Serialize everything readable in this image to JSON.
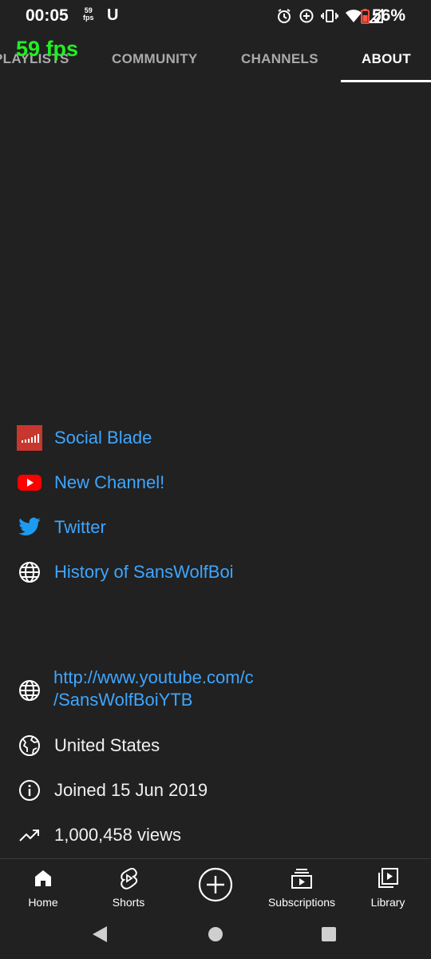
{
  "status_bar": {
    "time": "00:05",
    "fps_small_top": "59",
    "fps_small_bottom": "fps",
    "app_icon": "U",
    "battery": "56%"
  },
  "fps_overlay": "59 fps",
  "tabs": [
    {
      "label": "PLAYLISTS",
      "active": false
    },
    {
      "label": "COMMUNITY",
      "active": false
    },
    {
      "label": "CHANNELS",
      "active": false
    },
    {
      "label": "ABOUT",
      "active": true
    }
  ],
  "links": [
    {
      "label": "Social Blade",
      "icon": "social-blade-icon"
    },
    {
      "label": "New Channel!",
      "icon": "youtube-icon"
    },
    {
      "label": "Twitter",
      "icon": "twitter-icon"
    },
    {
      "label": "History of SansWolfBoi",
      "icon": "globe-icon"
    }
  ],
  "details": {
    "url_line1": "http://www.youtube.com/c",
    "url_line2": "/SansWolfBoiYTB",
    "country": "United States",
    "joined": "Joined 15 Jun 2019",
    "views": "1,000,458 views"
  },
  "bottom_nav": [
    {
      "label": "Home",
      "icon": "home-icon"
    },
    {
      "label": "Shorts",
      "icon": "shorts-icon"
    },
    {
      "label": "",
      "icon": "create-icon"
    },
    {
      "label": "Subscriptions",
      "icon": "subscriptions-icon"
    },
    {
      "label": "Library",
      "icon": "library-icon"
    }
  ],
  "colors": {
    "background": "#212121",
    "link": "#3ea6ff",
    "fps_overlay": "#22ee22",
    "youtube_red": "#ff0000",
    "twitter_blue": "#1d9bf0",
    "social_blade": "#c8372d"
  }
}
